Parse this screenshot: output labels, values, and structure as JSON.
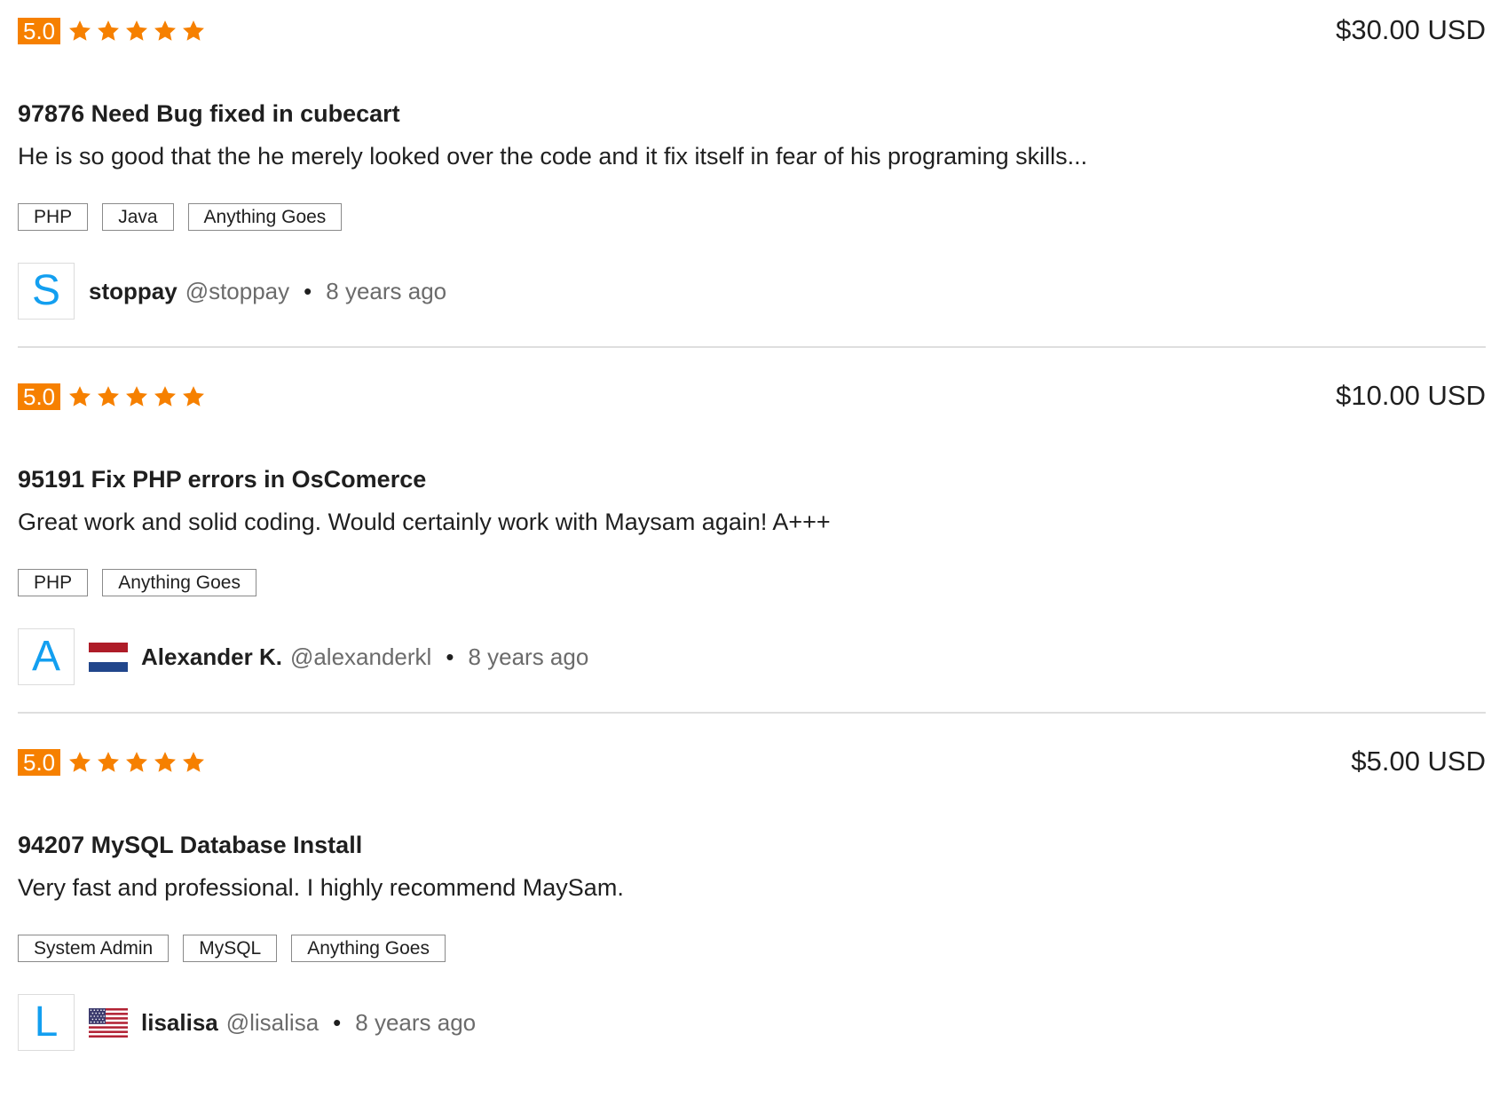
{
  "accent_color": "#f68000",
  "avatar_letter_color": "#139ff0",
  "reviews": [
    {
      "rating": "5.0",
      "stars": 5,
      "price": "$30.00 USD",
      "project_title": "97876 Need Bug fixed in cubecart",
      "text": "He is so good that the he merely looked over the code and it fix itself in fear of his programing skills...",
      "tags": [
        "PHP",
        "Java",
        "Anything Goes"
      ],
      "reviewer": {
        "avatar_letter": "S",
        "flag": "",
        "name": "stoppay",
        "handle": "@stoppay",
        "separator": "•",
        "time_ago": "8 years ago"
      }
    },
    {
      "rating": "5.0",
      "stars": 5,
      "price": "$10.00 USD",
      "project_title": "95191 Fix PHP errors in OsComerce",
      "text": "Great work and solid coding. Would certainly work with Maysam again! A+++",
      "tags": [
        "PHP",
        "Anything Goes"
      ],
      "reviewer": {
        "avatar_letter": "A",
        "flag": "netherlands-flag-icon",
        "name": "Alexander K.",
        "handle": "@alexanderkl",
        "separator": "•",
        "time_ago": "8 years ago"
      }
    },
    {
      "rating": "5.0",
      "stars": 5,
      "price": "$5.00 USD",
      "project_title": "94207 MySQL Database Install",
      "text": "Very fast and professional. I highly recommend MaySam.",
      "tags": [
        "System Admin",
        "MySQL",
        "Anything Goes"
      ],
      "reviewer": {
        "avatar_letter": "L",
        "flag": "usa-flag-icon",
        "name": "lisalisa",
        "handle": "@lisalisa",
        "separator": "•",
        "time_ago": "8 years ago"
      }
    }
  ]
}
